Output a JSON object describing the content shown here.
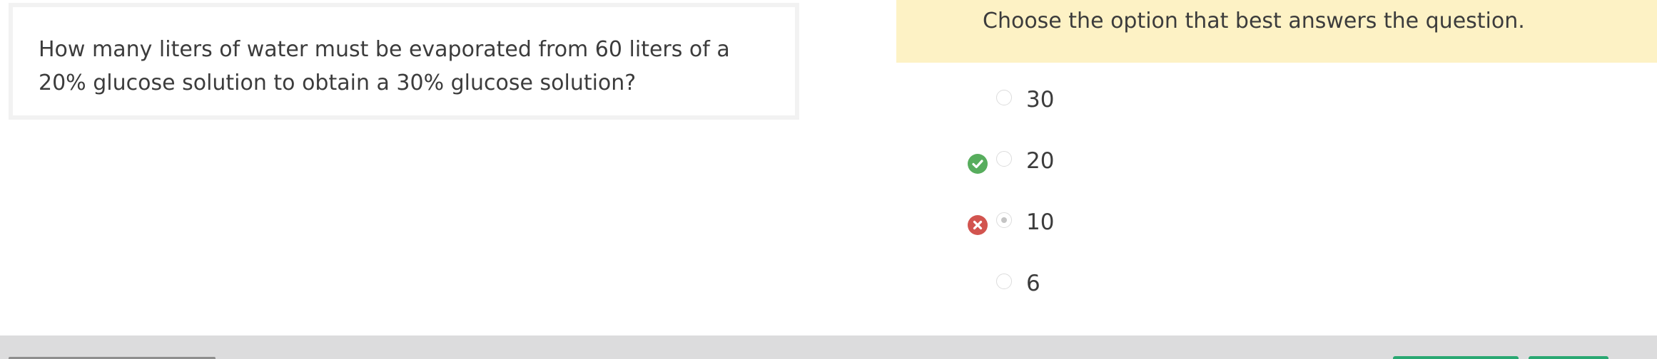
{
  "question": {
    "text": "How many liters of water must be evaporated from 60 liters of a 20% glucose solution to obtain a 30% glucose solution?"
  },
  "instruction": {
    "text": "Choose the option that best answers the question."
  },
  "options": [
    {
      "label": "30",
      "selected": false,
      "status": "none"
    },
    {
      "label": "20",
      "selected": false,
      "status": "correct"
    },
    {
      "label": "10",
      "selected": true,
      "status": "incorrect"
    },
    {
      "label": "6",
      "selected": false,
      "status": "none"
    }
  ],
  "colors": {
    "banner": "#fdf2c5",
    "correct": "#57ad5d",
    "incorrect": "#d2544f",
    "footer": "#dcdcdd",
    "footer_button": "#2aa872"
  }
}
